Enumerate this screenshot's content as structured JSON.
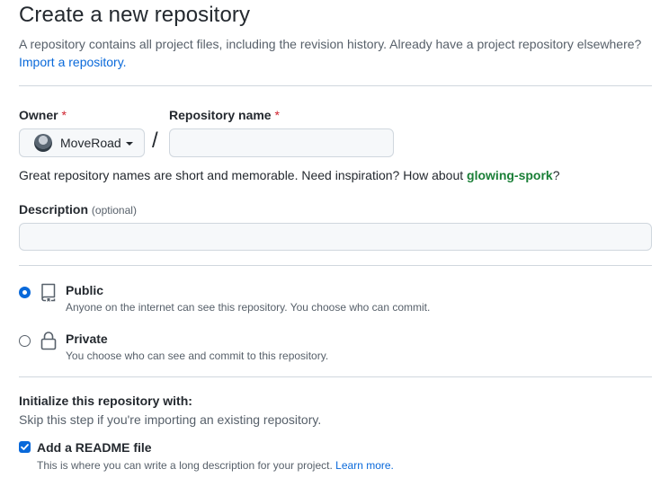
{
  "header": {
    "title": "Create a new repository",
    "subtitle": "A repository contains all project files, including the revision history. Already have a project repository elsewhere?",
    "import_link": "Import a repository."
  },
  "owner": {
    "label": "Owner",
    "required_mark": "*",
    "selected": "MoveRoad"
  },
  "separator": "/",
  "repo_name": {
    "label": "Repository name",
    "required_mark": "*",
    "value": "",
    "hint_prefix": "Great repository names are short and memorable. Need inspiration? How about",
    "suggestion": "glowing-spork",
    "hint_suffix": "?"
  },
  "description": {
    "label": "Description",
    "optional": "(optional)",
    "value": ""
  },
  "visibility": {
    "public": {
      "title": "Public",
      "desc": "Anyone on the internet can see this repository. You choose who can commit.",
      "checked": true
    },
    "private": {
      "title": "Private",
      "desc": "You choose who can see and commit to this repository.",
      "checked": false
    }
  },
  "initialize": {
    "heading": "Initialize this repository with:",
    "subtext": "Skip this step if you're importing an existing repository.",
    "readme_label": "Add a README file",
    "readme_checked": true,
    "readme_desc": "This is where you can write a long description for your project.",
    "learn_more": "Learn more."
  },
  "colors": {
    "accent": "#0969da",
    "required": "#cf222e",
    "suggestion": "#1a7f37",
    "muted": "#57606a"
  },
  "icons": {
    "public": "repo-book-icon",
    "private": "lock-icon",
    "owner_dropdown": "caret-down-icon"
  }
}
